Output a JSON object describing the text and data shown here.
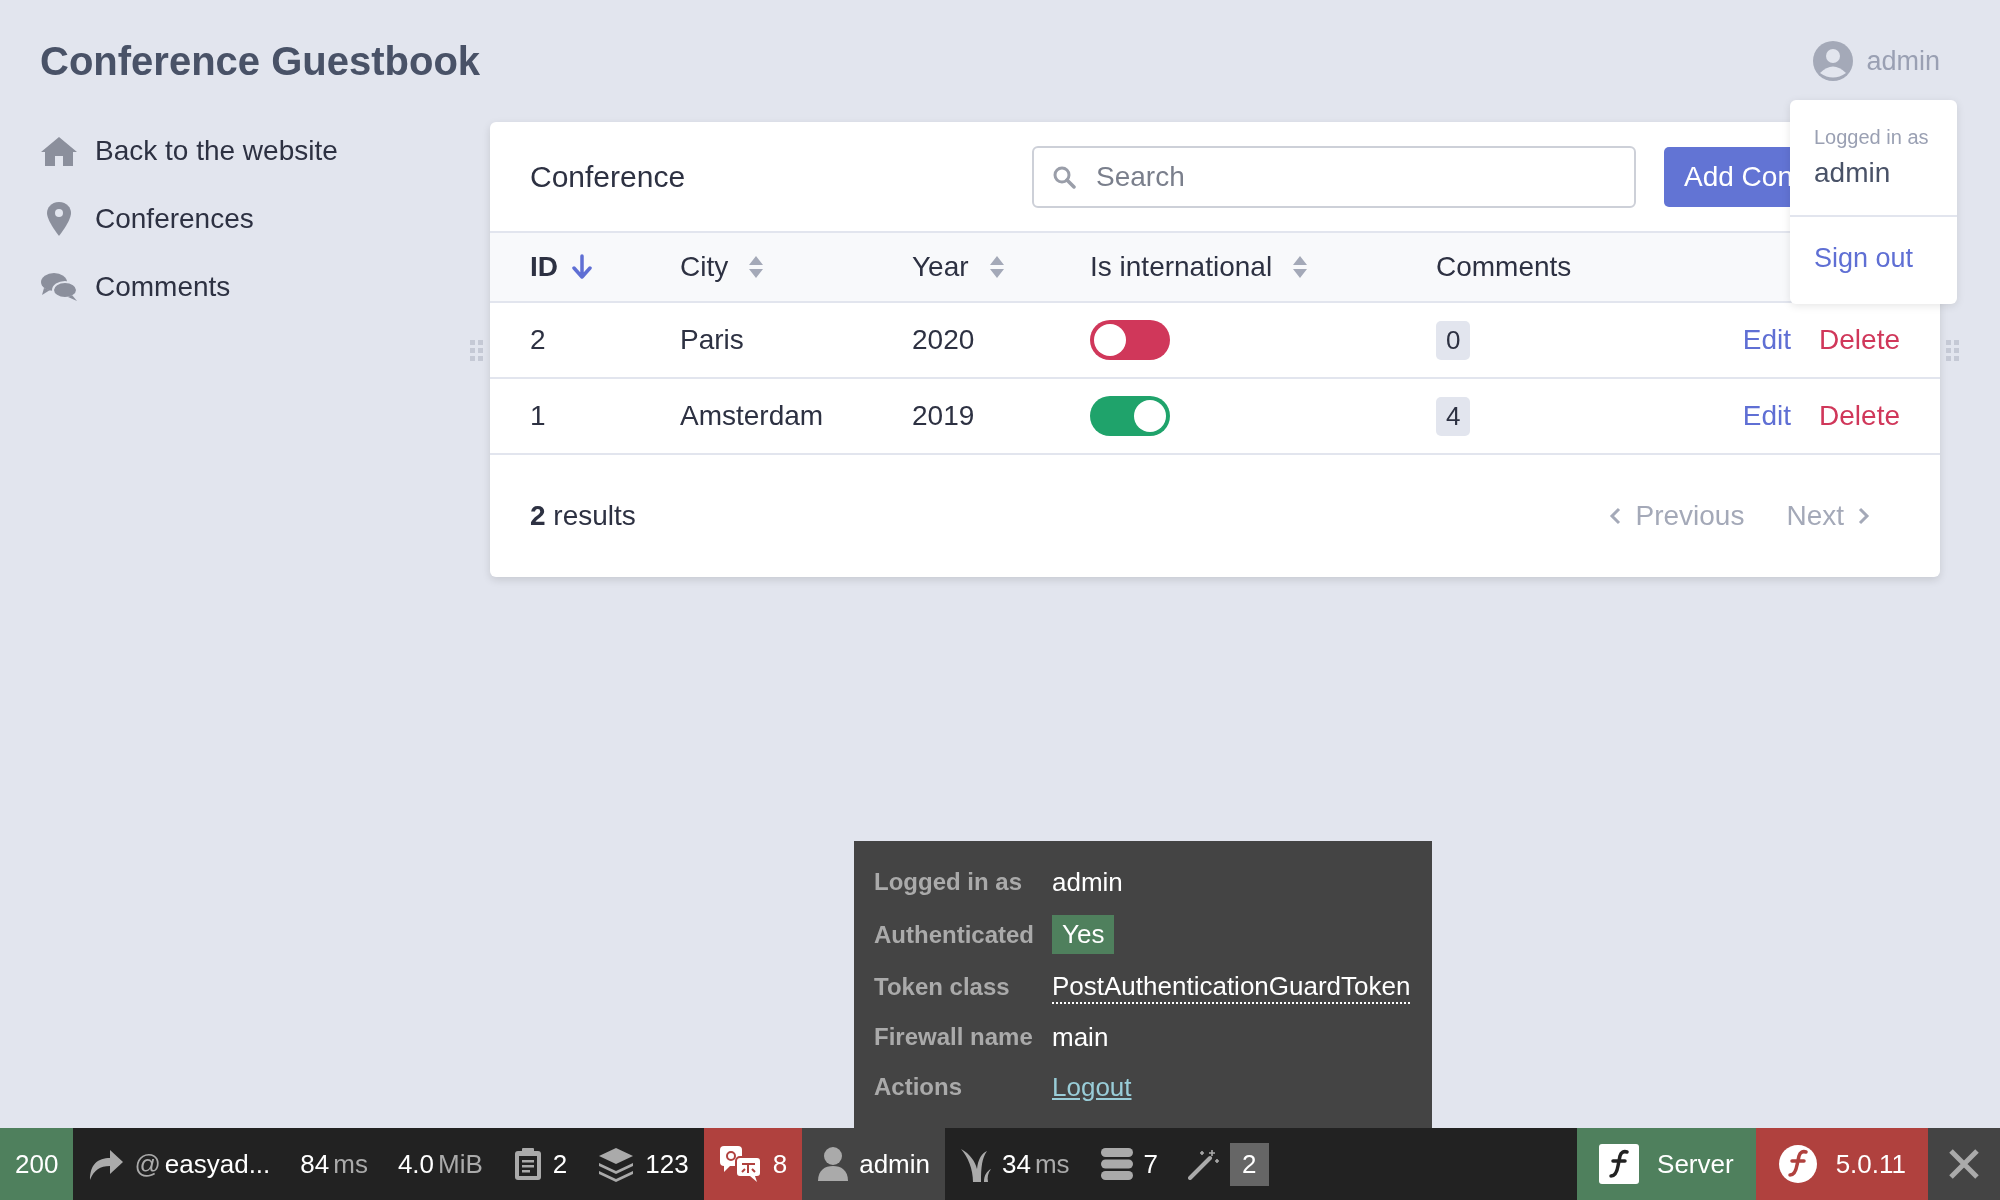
{
  "header": {
    "title": "Conference Guestbook",
    "user": "admin"
  },
  "user_menu": {
    "caption": "Logged in as",
    "user": "admin",
    "sign_out": "Sign out"
  },
  "sidebar": {
    "items": [
      {
        "kind": "home",
        "label": "Back to the website"
      },
      {
        "kind": "place",
        "label": "Conferences"
      },
      {
        "kind": "comments",
        "label": "Comments"
      }
    ]
  },
  "card": {
    "title": "Conference",
    "search": {
      "placeholder": "Search"
    },
    "add_button": "Add Con",
    "columns": [
      {
        "label": "ID",
        "sortable": true,
        "sorted": true
      },
      {
        "label": "City",
        "sortable": true,
        "sorted": false
      },
      {
        "label": "Year",
        "sortable": true,
        "sorted": false
      },
      {
        "label": "Is international",
        "sortable": true,
        "sorted": false
      },
      {
        "label": "Comments",
        "sortable": false,
        "sorted": false
      }
    ],
    "rows": [
      {
        "id": "2",
        "city": "Paris",
        "year": "2020",
        "international": false,
        "comments": "0",
        "edit": "Edit",
        "delete": "Delete"
      },
      {
        "id": "1",
        "city": "Amsterdam",
        "year": "2019",
        "international": true,
        "comments": "4",
        "edit": "Edit",
        "delete": "Delete"
      }
    ],
    "footer": {
      "results": "**2** results",
      "previous": {
        "label": "Previous",
        "disabled": true
      },
      "next": {
        "label": "Next",
        "disabled": true
      }
    }
  },
  "popup": {
    "rows": [
      {
        "kind": "text",
        "label": "Logged in as",
        "value": "admin"
      },
      {
        "kind": "badge",
        "label": "Authenticated",
        "value": "Yes"
      },
      {
        "kind": "abbr",
        "label": "Token class",
        "value": "PostAuthenticationGuardToken"
      },
      {
        "kind": "text",
        "label": "Firewall name",
        "value": "main"
      },
      {
        "kind": "link",
        "label": "Actions",
        "value": "Logout"
      }
    ]
  },
  "toolbar": {
    "items": [
      {
        "kind": "status",
        "value": "200",
        "color": "#4f805d"
      },
      {
        "kind": "request",
        "prefix": "@",
        "value": "easyad...",
        "color": "#222222"
      },
      {
        "kind": "time",
        "value": "84",
        "unit": "ms",
        "color": "#222222"
      },
      {
        "kind": "memory",
        "value": "4.0",
        "unit": "MiB",
        "color": "#222222"
      },
      {
        "kind": "logger",
        "value": "2",
        "color": "#222222"
      },
      {
        "kind": "cache",
        "value": "123",
        "color": "#222222"
      },
      {
        "kind": "translation",
        "value": "8",
        "color": "#b0413e"
      },
      {
        "kind": "security",
        "value": "admin",
        "color": "#444444"
      },
      {
        "kind": "twig",
        "value": "34",
        "unit": "ms",
        "color": "#222222"
      },
      {
        "kind": "db",
        "value": "7",
        "color": "#222222"
      },
      {
        "kind": "forms",
        "value": "2",
        "color": "#222222"
      },
      {
        "kind": "server",
        "value": "Server",
        "color": "#4f805d"
      },
      {
        "kind": "version",
        "value": "5.0.11",
        "color": "#b0413e"
      }
    ]
  }
}
